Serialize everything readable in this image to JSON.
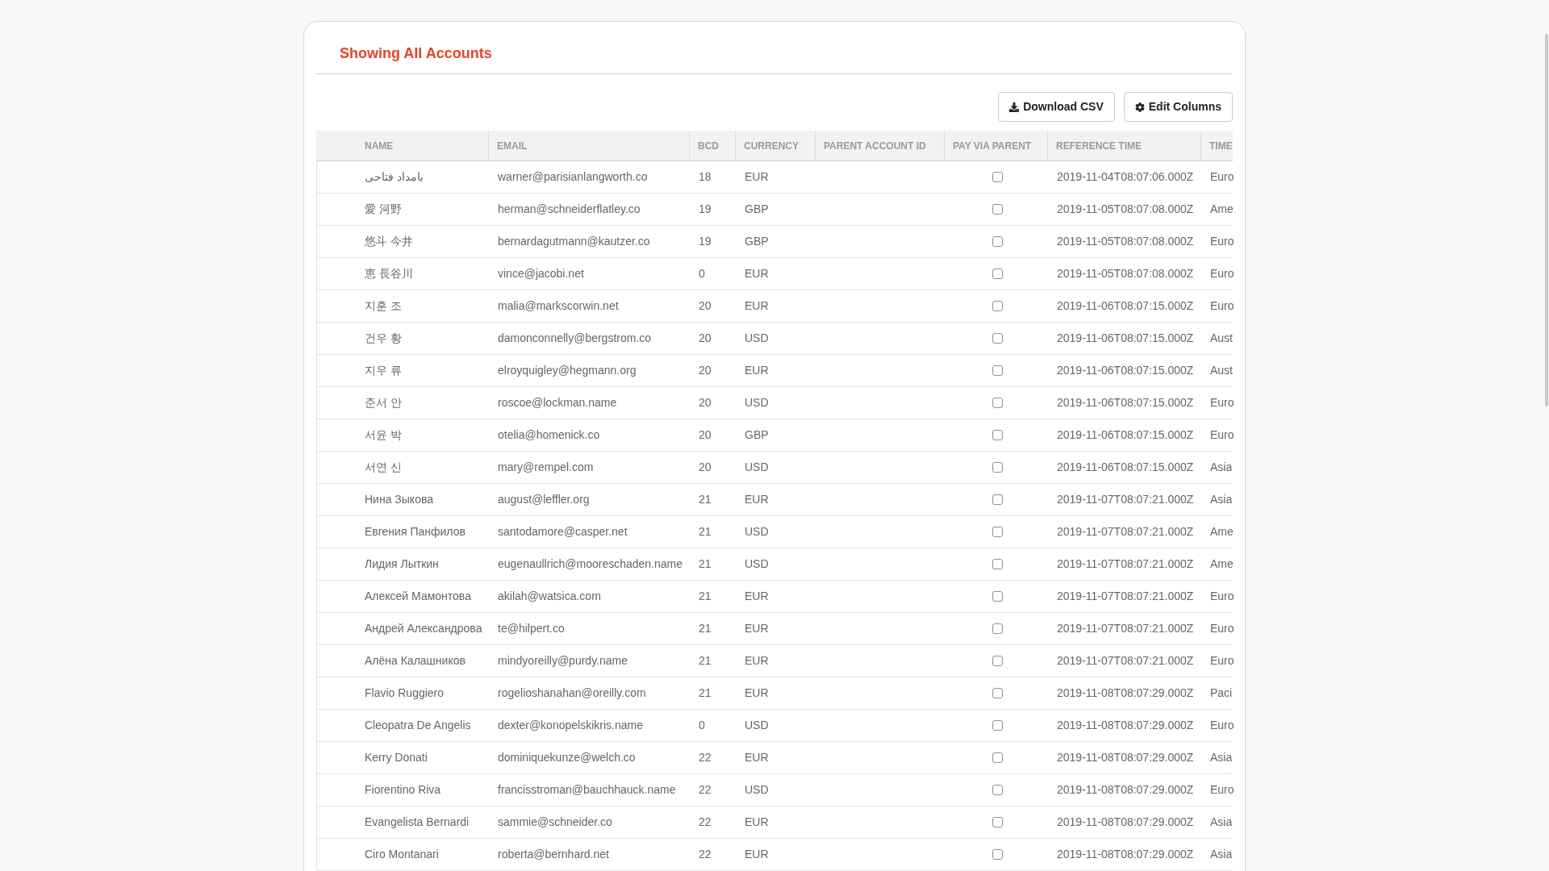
{
  "page": {
    "title": "Showing All Accounts"
  },
  "toolbar": {
    "download_button": "Download CSV",
    "edit_columns_button": "Edit Columns"
  },
  "table": {
    "columns": [
      "NAME",
      "EMAIL",
      "BCD",
      "CURRENCY",
      "PARENT ACCOUNT ID",
      "PAY VIA PARENT",
      "REFERENCE TIME",
      "TIME"
    ],
    "rows": [
      {
        "name": "بامداد فتاحی",
        "email": "warner@parisianlangworth.co",
        "bcd": "18",
        "currency": "EUR",
        "pay_via_parent": false,
        "reference_time": "2019-11-04T08:07:06.000Z",
        "time": "Euro"
      },
      {
        "name": "愛 河野",
        "email": "herman@schneiderflatley.co",
        "bcd": "19",
        "currency": "GBP",
        "pay_via_parent": false,
        "reference_time": "2019-11-05T08:07:08.000Z",
        "time": "Ame"
      },
      {
        "name": "悠斗 今井",
        "email": "bernardagutmann@kautzer.co",
        "bcd": "19",
        "currency": "GBP",
        "pay_via_parent": false,
        "reference_time": "2019-11-05T08:07:08.000Z",
        "time": "Euro"
      },
      {
        "name": "恵 長谷川",
        "email": "vince@jacobi.net",
        "bcd": "0",
        "currency": "EUR",
        "pay_via_parent": false,
        "reference_time": "2019-11-05T08:07:08.000Z",
        "time": "Euro"
      },
      {
        "name": "지훈 조",
        "email": "malia@markscorwin.net",
        "bcd": "20",
        "currency": "EUR",
        "pay_via_parent": false,
        "reference_time": "2019-11-06T08:07:15.000Z",
        "time": "Euro"
      },
      {
        "name": "건우 황",
        "email": "damonconnelly@bergstrom.co",
        "bcd": "20",
        "currency": "USD",
        "pay_via_parent": false,
        "reference_time": "2019-11-06T08:07:15.000Z",
        "time": "Aust"
      },
      {
        "name": "지우 류",
        "email": "elroyquigley@hegmann.org",
        "bcd": "20",
        "currency": "EUR",
        "pay_via_parent": false,
        "reference_time": "2019-11-06T08:07:15.000Z",
        "time": "Aust"
      },
      {
        "name": "준서 안",
        "email": "roscoe@lockman.name",
        "bcd": "20",
        "currency": "USD",
        "pay_via_parent": false,
        "reference_time": "2019-11-06T08:07:15.000Z",
        "time": "Euro"
      },
      {
        "name": "서윤 박",
        "email": "otelia@homenick.co",
        "bcd": "20",
        "currency": "GBP",
        "pay_via_parent": false,
        "reference_time": "2019-11-06T08:07:15.000Z",
        "time": "Euro"
      },
      {
        "name": "서연 신",
        "email": "mary@rempel.com",
        "bcd": "20",
        "currency": "USD",
        "pay_via_parent": false,
        "reference_time": "2019-11-06T08:07:15.000Z",
        "time": "Asia"
      },
      {
        "name": "Нина Зыкова",
        "email": "august@leffler.org",
        "bcd": "21",
        "currency": "EUR",
        "pay_via_parent": false,
        "reference_time": "2019-11-07T08:07:21.000Z",
        "time": "Asia"
      },
      {
        "name": "Евгения Панфилов",
        "email": "santodamore@casper.net",
        "bcd": "21",
        "currency": "USD",
        "pay_via_parent": false,
        "reference_time": "2019-11-07T08:07:21.000Z",
        "time": "Ame"
      },
      {
        "name": "Лидия Лыткин",
        "email": "eugenaullrich@mooreschaden.name",
        "bcd": "21",
        "currency": "USD",
        "pay_via_parent": false,
        "reference_time": "2019-11-07T08:07:21.000Z",
        "time": "Ame"
      },
      {
        "name": "Алексей Мамонтова",
        "email": "akilah@watsica.com",
        "bcd": "21",
        "currency": "EUR",
        "pay_via_parent": false,
        "reference_time": "2019-11-07T08:07:21.000Z",
        "time": "Euro"
      },
      {
        "name": "Андрей Александрова",
        "email": "te@hilpert.co",
        "bcd": "21",
        "currency": "EUR",
        "pay_via_parent": false,
        "reference_time": "2019-11-07T08:07:21.000Z",
        "time": "Euro"
      },
      {
        "name": "Алёна Калашников",
        "email": "mindyoreilly@purdy.name",
        "bcd": "21",
        "currency": "EUR",
        "pay_via_parent": false,
        "reference_time": "2019-11-07T08:07:21.000Z",
        "time": "Euro"
      },
      {
        "name": "Flavio Ruggiero",
        "email": "rogelioshanahan@oreilly.com",
        "bcd": "21",
        "currency": "EUR",
        "pay_via_parent": false,
        "reference_time": "2019-11-08T08:07:29.000Z",
        "time": "Paci"
      },
      {
        "name": "Cleopatra De Angelis",
        "email": "dexter@konopelskikris.name",
        "bcd": "0",
        "currency": "USD",
        "pay_via_parent": false,
        "reference_time": "2019-11-08T08:07:29.000Z",
        "time": "Euro"
      },
      {
        "name": "Kerry Donati",
        "email": "dominiquekunze@welch.co",
        "bcd": "22",
        "currency": "EUR",
        "pay_via_parent": false,
        "reference_time": "2019-11-08T08:07:29.000Z",
        "time": "Asia"
      },
      {
        "name": "Fiorentino Riva",
        "email": "francisstroman@bauchhauck.name",
        "bcd": "22",
        "currency": "USD",
        "pay_via_parent": false,
        "reference_time": "2019-11-08T08:07:29.000Z",
        "time": "Euro"
      },
      {
        "name": "Evangelista Bernardi",
        "email": "sammie@schneider.co",
        "bcd": "22",
        "currency": "EUR",
        "pay_via_parent": false,
        "reference_time": "2019-11-08T08:07:29.000Z",
        "time": "Asia"
      },
      {
        "name": "Ciro Montanari",
        "email": "roberta@bernhard.net",
        "bcd": "22",
        "currency": "EUR",
        "pay_via_parent": false,
        "reference_time": "2019-11-08T08:07:29.000Z",
        "time": "Asia"
      }
    ]
  }
}
